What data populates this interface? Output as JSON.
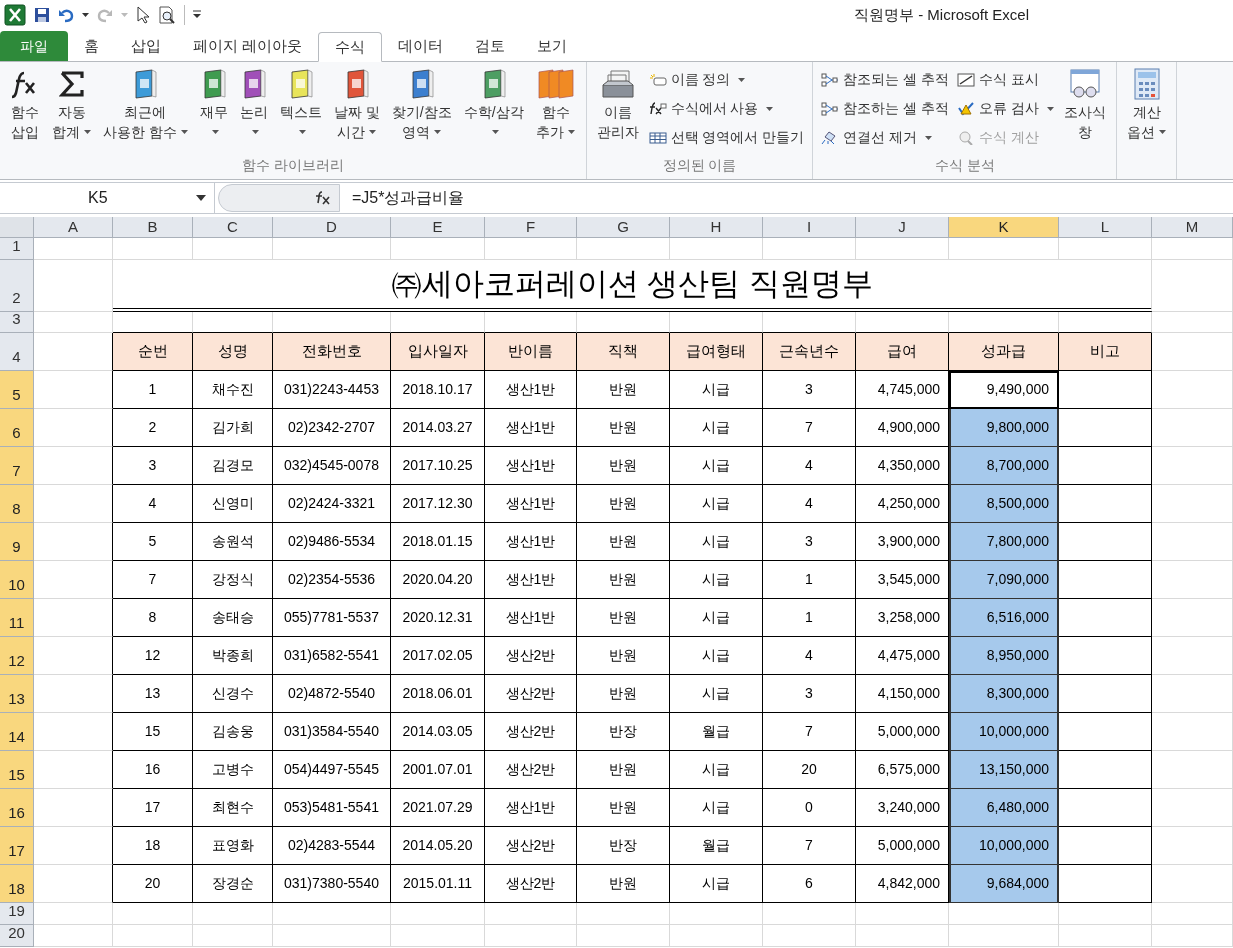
{
  "window": {
    "title": "직원명부 - Microsoft Excel"
  },
  "tabs": [
    {
      "label": "파일",
      "kind": "file",
      "selected": false
    },
    {
      "label": "홈",
      "kind": "tab",
      "selected": false
    },
    {
      "label": "삽입",
      "kind": "tab",
      "selected": false
    },
    {
      "label": "페이지 레이아웃",
      "kind": "tab",
      "selected": false
    },
    {
      "label": "수식",
      "kind": "tab",
      "selected": true
    },
    {
      "label": "데이터",
      "kind": "tab",
      "selected": false
    },
    {
      "label": "검토",
      "kind": "tab",
      "selected": false
    },
    {
      "label": "보기",
      "kind": "tab",
      "selected": false
    }
  ],
  "ribbon": {
    "groups": [
      {
        "label": "함수 라이브러리",
        "items": [
          {
            "kind": "large",
            "lines": [
              "함수",
              "삽입"
            ],
            "dropdown": false
          },
          {
            "kind": "large",
            "lines": [
              "자동",
              "합계"
            ],
            "dropdown": true
          },
          {
            "kind": "large",
            "lines": [
              "최근에",
              "사용한 함수"
            ],
            "dropdown": true
          },
          {
            "kind": "large",
            "lines": [
              "재무"
            ],
            "dropdown": true
          },
          {
            "kind": "large",
            "lines": [
              "논리"
            ],
            "dropdown": true
          },
          {
            "kind": "large",
            "lines": [
              "텍스트"
            ],
            "dropdown": true
          },
          {
            "kind": "large",
            "lines": [
              "날짜 및",
              "시간"
            ],
            "dropdown": true
          },
          {
            "kind": "large",
            "lines": [
              "찾기/참조",
              "영역"
            ],
            "dropdown": true
          },
          {
            "kind": "large",
            "lines": [
              "수학/삼각"
            ],
            "dropdown": true
          },
          {
            "kind": "large",
            "lines": [
              "함수",
              "추가"
            ],
            "dropdown": true
          }
        ]
      },
      {
        "label": "정의된 이름",
        "items": [
          {
            "kind": "large",
            "lines": [
              "이름",
              "관리자"
            ],
            "dropdown": false
          },
          {
            "kind": "column",
            "entries": [
              {
                "label": "이름 정의",
                "dropdown": true,
                "disabled": false
              },
              {
                "label": "수식에서 사용",
                "dropdown": true,
                "disabled": false
              },
              {
                "label": "선택 영역에서 만들기",
                "dropdown": false,
                "disabled": false
              }
            ]
          }
        ]
      },
      {
        "label": "수식 분석",
        "items": [
          {
            "kind": "column",
            "entries": [
              {
                "label": "참조되는 셀 추적",
                "dropdown": false,
                "disabled": false
              },
              {
                "label": "참조하는 셀 추적",
                "dropdown": false,
                "disabled": false
              },
              {
                "label": "연결선 제거",
                "dropdown": true,
                "disabled": false
              }
            ]
          },
          {
            "kind": "column",
            "entries": [
              {
                "label": "수식 표시",
                "dropdown": false,
                "disabled": false
              },
              {
                "label": "오류 검사",
                "dropdown": true,
                "disabled": false
              },
              {
                "label": "수식 계산",
                "dropdown": false,
                "disabled": true
              }
            ]
          },
          {
            "kind": "large",
            "lines": [
              "조사식",
              "창"
            ],
            "dropdown": false
          }
        ]
      },
      {
        "items": [
          {
            "kind": "large",
            "lines": [
              "계산",
              "옵션"
            ],
            "dropdown": true
          }
        ]
      }
    ]
  },
  "name_box": "K5",
  "formula": "=J5*성과급비율",
  "column_headers": [
    {
      "label": "A",
      "selected": false
    },
    {
      "label": "B",
      "selected": false
    },
    {
      "label": "C",
      "selected": false
    },
    {
      "label": "D",
      "selected": false
    },
    {
      "label": "E",
      "selected": false
    },
    {
      "label": "F",
      "selected": false
    },
    {
      "label": "G",
      "selected": false
    },
    {
      "label": "H",
      "selected": false
    },
    {
      "label": "I",
      "selected": false
    },
    {
      "label": "J",
      "selected": false
    },
    {
      "label": "K",
      "selected": true
    },
    {
      "label": "L",
      "selected": false
    },
    {
      "label": "M",
      "selected": false
    }
  ],
  "row_headers": [
    {
      "label": "1",
      "selected": false
    },
    {
      "label": "2",
      "selected": false
    },
    {
      "label": "3",
      "selected": false
    },
    {
      "label": "4",
      "selected": false
    },
    {
      "label": "5",
      "selected": true
    },
    {
      "label": "6",
      "selected": true
    },
    {
      "label": "7",
      "selected": true
    },
    {
      "label": "8",
      "selected": true
    },
    {
      "label": "9",
      "selected": true
    },
    {
      "label": "10",
      "selected": true
    },
    {
      "label": "11",
      "selected": true
    },
    {
      "label": "12",
      "selected": true
    },
    {
      "label": "13",
      "selected": true
    },
    {
      "label": "14",
      "selected": true
    },
    {
      "label": "15",
      "selected": true
    },
    {
      "label": "16",
      "selected": true
    },
    {
      "label": "17",
      "selected": true
    },
    {
      "label": "18",
      "selected": true
    },
    {
      "label": "19",
      "selected": false
    },
    {
      "label": "20",
      "selected": false
    }
  ],
  "sheet": {
    "title": "㈜세아코퍼레이션 생산팀 직원명부",
    "header": [
      "순번",
      "성명",
      "전화번호",
      "입사일자",
      "반이름",
      "직책",
      "급여형태",
      "근속년수",
      "급여",
      "성과급",
      "비고"
    ],
    "rows": [
      {
        "cells": [
          "1",
          "채수진",
          "031)2243-4453",
          "2018.10.17",
          "생산1반",
          "반원",
          "시급",
          "3",
          "4,745,000",
          "9,490,000"
        ],
        "active": true,
        "selected": true
      },
      {
        "cells": [
          "2",
          "김가희",
          "02)2342-2707",
          "2014.03.27",
          "생산1반",
          "반원",
          "시급",
          "7",
          "4,900,000",
          "9,800,000"
        ],
        "active": false,
        "selected": true
      },
      {
        "cells": [
          "3",
          "김경모",
          "032)4545-0078",
          "2017.10.25",
          "생산1반",
          "반원",
          "시급",
          "4",
          "4,350,000",
          "8,700,000"
        ],
        "active": false,
        "selected": true
      },
      {
        "cells": [
          "4",
          "신영미",
          "02)2424-3321",
          "2017.12.30",
          "생산1반",
          "반원",
          "시급",
          "4",
          "4,250,000",
          "8,500,000"
        ],
        "active": false,
        "selected": true
      },
      {
        "cells": [
          "5",
          "송원석",
          "02)9486-5534",
          "2018.01.15",
          "생산1반",
          "반원",
          "시급",
          "3",
          "3,900,000",
          "7,800,000"
        ],
        "active": false,
        "selected": true
      },
      {
        "cells": [
          "7",
          "강정식",
          "02)2354-5536",
          "2020.04.20",
          "생산1반",
          "반원",
          "시급",
          "1",
          "3,545,000",
          "7,090,000"
        ],
        "active": false,
        "selected": true
      },
      {
        "cells": [
          "8",
          "송태승",
          "055)7781-5537",
          "2020.12.31",
          "생산1반",
          "반원",
          "시급",
          "1",
          "3,258,000",
          "6,516,000"
        ],
        "active": false,
        "selected": true
      },
      {
        "cells": [
          "12",
          "박종희",
          "031)6582-5541",
          "2017.02.05",
          "생산2반",
          "반원",
          "시급",
          "4",
          "4,475,000",
          "8,950,000"
        ],
        "active": false,
        "selected": true
      },
      {
        "cells": [
          "13",
          "신경수",
          "02)4872-5540",
          "2018.06.01",
          "생산2반",
          "반원",
          "시급",
          "3",
          "4,150,000",
          "8,300,000"
        ],
        "active": false,
        "selected": true
      },
      {
        "cells": [
          "15",
          "김송웅",
          "031)3584-5540",
          "2014.03.05",
          "생산2반",
          "반장",
          "월급",
          "7",
          "5,000,000",
          "10,000,000"
        ],
        "active": false,
        "selected": true
      },
      {
        "cells": [
          "16",
          "고병수",
          "054)4497-5545",
          "2001.07.01",
          "생산2반",
          "반원",
          "시급",
          "20",
          "6,575,000",
          "13,150,000"
        ],
        "active": false,
        "selected": true
      },
      {
        "cells": [
          "17",
          "최현수",
          "053)5481-5541",
          "2021.07.29",
          "생산1반",
          "반원",
          "시급",
          "0",
          "3,240,000",
          "6,480,000"
        ],
        "active": false,
        "selected": true
      },
      {
        "cells": [
          "18",
          "표영화",
          "02)4283-5544",
          "2014.05.20",
          "생산2반",
          "반장",
          "월급",
          "7",
          "5,000,000",
          "10,000,000"
        ],
        "active": false,
        "selected": true
      },
      {
        "cells": [
          "20",
          "장경순",
          "031)7380-5540",
          "2015.01.11",
          "생산2반",
          "반원",
          "시급",
          "6",
          "4,842,000",
          "9,684,000"
        ],
        "active": false,
        "selected": true
      }
    ]
  }
}
